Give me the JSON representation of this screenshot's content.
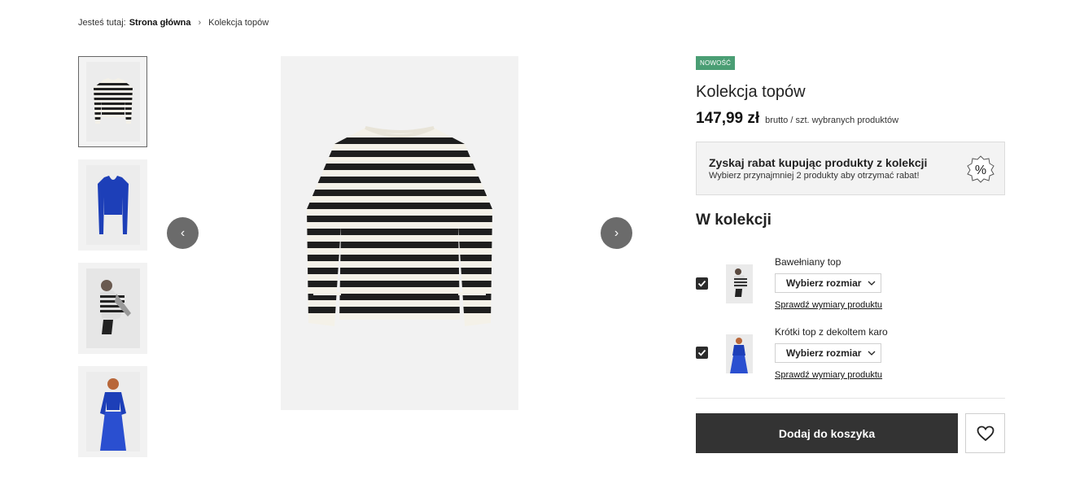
{
  "breadcrumb": {
    "prefix": "Jesteś tutaj:",
    "home": "Strona główna",
    "separator": "›",
    "current": "Kolekcja topów"
  },
  "gallery": {
    "thumbnails": [
      {
        "name": "striped-sweater"
      },
      {
        "name": "blue-top"
      },
      {
        "name": "model-striped"
      },
      {
        "name": "model-blue"
      }
    ],
    "prev_icon": "‹",
    "next_icon": "›"
  },
  "product": {
    "badge": "NOWOŚĆ",
    "title": "Kolekcja topów",
    "price": "147,99 zł",
    "price_note": "brutto / szt. wybranych produktów",
    "badge_color": "#4a9e74"
  },
  "promo": {
    "heading": "Zyskaj rabat kupując produkty z kolekcji",
    "subtext": "Wybierz przynajmniej 2 produkty aby otrzymać rabat!",
    "icon_text": "%"
  },
  "collection": {
    "title": "W kolekcji",
    "items": [
      {
        "name": "Bawełniany top",
        "size_label": "Wybierz rozmiar",
        "size_link": "Sprawdź wymiary produktu",
        "checked": true
      },
      {
        "name": "Krótki top z dekoltem karo",
        "size_label": "Wybierz rozmiar",
        "size_link": "Sprawdź wymiary produktu",
        "checked": true
      }
    ]
  },
  "actions": {
    "add_to_cart": "Dodaj do koszyka",
    "wishlist_icon": "heart-icon"
  }
}
